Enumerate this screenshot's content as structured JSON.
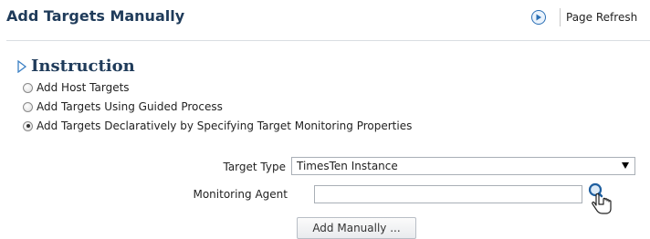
{
  "header": {
    "title": "Add Targets Manually",
    "refresh_label": "Page Refresh"
  },
  "instruction": {
    "title": "Instruction",
    "options": [
      {
        "label": "Add Host Targets",
        "selected": false
      },
      {
        "label": "Add Targets Using Guided Process",
        "selected": false
      },
      {
        "label": "Add Targets Declaratively by Specifying Target Monitoring Properties",
        "selected": true
      }
    ]
  },
  "form": {
    "target_type_label": "Target Type",
    "target_type_value": "TimesTen Instance",
    "monitoring_agent_label": "Monitoring Agent",
    "monitoring_agent_value": "",
    "add_button_label": "Add Manually ..."
  },
  "colors": {
    "title": "#1f3b5a",
    "accent": "#2a6fb5"
  },
  "icons": [
    "refresh-icon",
    "disclosure-triangle-icon",
    "search-icon",
    "hand-cursor-icon"
  ]
}
